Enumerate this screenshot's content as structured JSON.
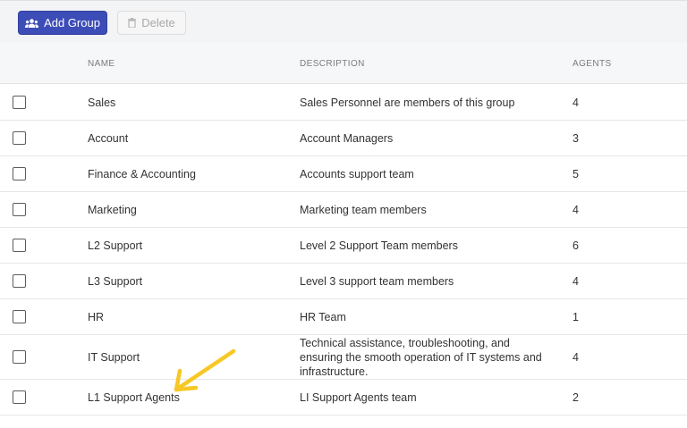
{
  "toolbar": {
    "add_label": "Add Group",
    "add_icon": "group-add-icon",
    "delete_label": "Delete",
    "delete_icon": "trash-icon"
  },
  "table": {
    "columns": {
      "name": "NAME",
      "description": "DESCRIPTION",
      "agents": "AGENTS"
    },
    "rows": [
      {
        "name": "Sales",
        "description": "Sales Personnel are members of this group",
        "agents": "4"
      },
      {
        "name": "Account",
        "description": "Account Managers",
        "agents": "3"
      },
      {
        "name": "Finance & Accounting",
        "description": "Accounts support team",
        "agents": "5"
      },
      {
        "name": "Marketing",
        "description": "Marketing team members",
        "agents": "4"
      },
      {
        "name": "L2 Support",
        "description": "Level 2 Support Team members",
        "agents": "6"
      },
      {
        "name": "L3 Support",
        "description": "Level 3 support team members",
        "agents": "4"
      },
      {
        "name": "HR",
        "description": "HR Team",
        "agents": "1"
      },
      {
        "name": "IT Support",
        "description": "Technical assistance, troubleshooting, and ensuring the smooth operation of IT systems and infrastructure.",
        "agents": "4"
      },
      {
        "name": "L1 Support Agents",
        "description": "LI Support Agents team",
        "agents": "2"
      }
    ]
  },
  "annotation": {
    "arrow_color": "#f7c825"
  }
}
